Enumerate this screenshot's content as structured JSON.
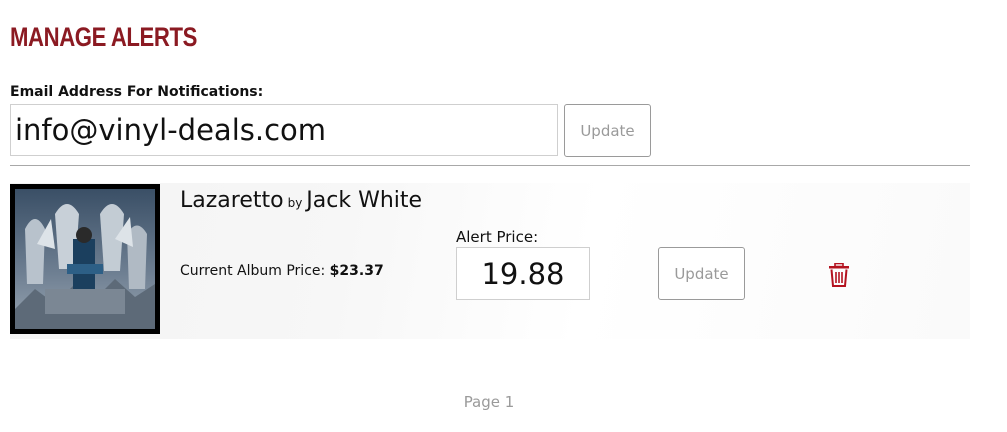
{
  "page": {
    "title": "Manage Alerts"
  },
  "email": {
    "label": "Email Address For Notifications:",
    "value": "info@vinyl-deals.com",
    "update_label": "Update"
  },
  "alerts": [
    {
      "album": "Lazaretto",
      "by": "by",
      "artist": "Jack White",
      "current_price_label": "Current Album Price:",
      "current_price": "$23.37",
      "alert_price_label": "Alert Price:",
      "alert_price": "19.88",
      "update_label": "Update",
      "delete_icon": "trash-icon",
      "accent": "#b4121f"
    }
  ],
  "pager": {
    "label": "Page 1"
  },
  "colors": {
    "title": "#8b1a22",
    "button_text": "#9a9a9a",
    "delete": "#b4121f"
  }
}
